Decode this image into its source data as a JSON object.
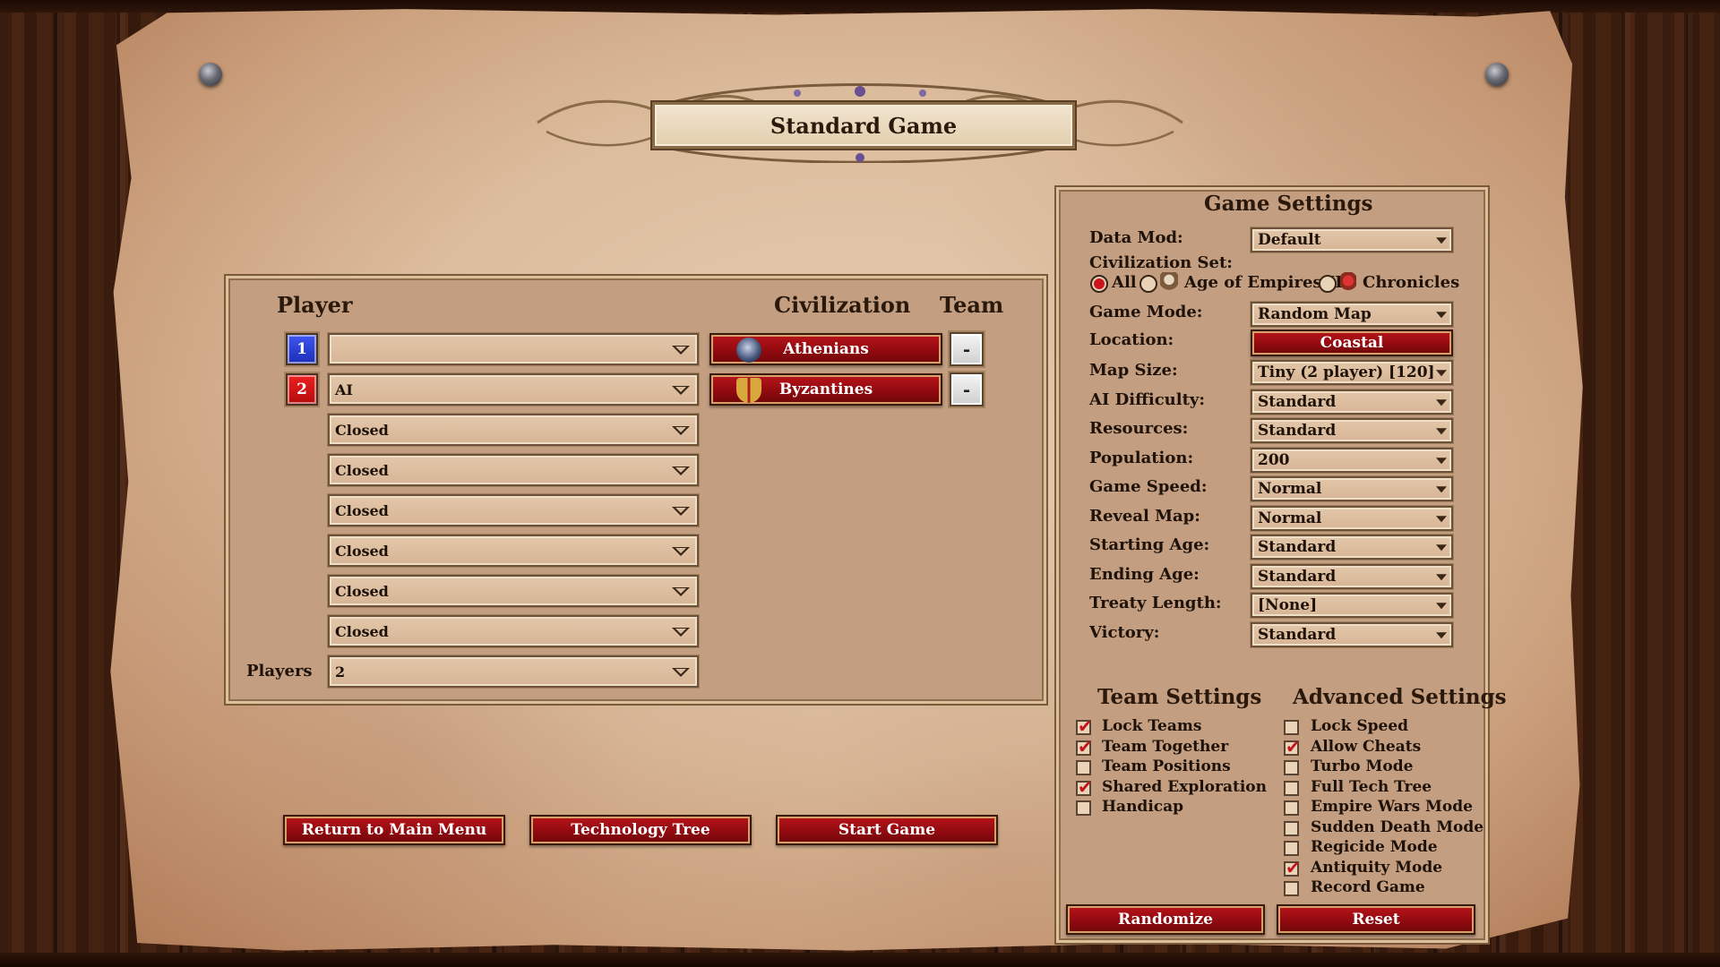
{
  "title": "Standard Game",
  "players_panel": {
    "header_player": "Player",
    "header_civ": "Civilization",
    "header_team": "Team",
    "rows": [
      {
        "number": "1",
        "color": "#2a3ed6",
        "slot": "",
        "civ": "Athenians",
        "team": "-"
      },
      {
        "number": "2",
        "color": "#d71616",
        "slot": "AI",
        "civ": "Byzantines",
        "team": "-"
      },
      {
        "slot": "Closed"
      },
      {
        "slot": "Closed"
      },
      {
        "slot": "Closed"
      },
      {
        "slot": "Closed"
      },
      {
        "slot": "Closed"
      },
      {
        "slot": "Closed"
      }
    ],
    "players_label": "Players",
    "players_value": "2"
  },
  "bottom_buttons": {
    "return": "Return to Main Menu",
    "tech_tree": "Technology Tree",
    "start": "Start Game"
  },
  "settings": {
    "header": "Game Settings",
    "data_mod_label": "Data Mod:",
    "data_mod": "Default",
    "civ_set_label": "Civilization Set:",
    "civ_set_options": [
      "All",
      "Age of Empires II",
      "Chronicles"
    ],
    "civ_set_selected": "All",
    "game_mode_label": "Game Mode:",
    "game_mode": "Random Map",
    "location_label": "Location:",
    "location": "Coastal",
    "map_size_label": "Map Size:",
    "map_size": "Tiny (2 player) [120]",
    "ai_difficulty_label": "AI Difficulty:",
    "ai_difficulty": "Standard",
    "resources_label": "Resources:",
    "resources": "Standard",
    "population_label": "Population:",
    "population": "200",
    "game_speed_label": "Game Speed:",
    "game_speed": "Normal",
    "reveal_map_label": "Reveal Map:",
    "reveal_map": "Normal",
    "starting_age_label": "Starting Age:",
    "starting_age": "Standard",
    "ending_age_label": "Ending Age:",
    "ending_age": "Standard",
    "treaty_length_label": "Treaty Length:",
    "treaty_length": "[None]",
    "victory_label": "Victory:",
    "victory": "Standard"
  },
  "team_settings": {
    "header": "Team Settings",
    "items": [
      {
        "label": "Lock Teams",
        "checked": true
      },
      {
        "label": "Team Together",
        "checked": true
      },
      {
        "label": "Team Positions",
        "checked": false
      },
      {
        "label": "Shared Exploration",
        "checked": true
      },
      {
        "label": "Handicap",
        "checked": false
      }
    ]
  },
  "advanced_settings": {
    "header": "Advanced Settings",
    "items": [
      {
        "label": "Lock Speed",
        "checked": false
      },
      {
        "label": "Allow Cheats",
        "checked": true
      },
      {
        "label": "Turbo Mode",
        "checked": false
      },
      {
        "label": "Full Tech Tree",
        "checked": false
      },
      {
        "label": "Empire Wars Mode",
        "checked": false
      },
      {
        "label": "Sudden Death Mode",
        "checked": false
      },
      {
        "label": "Regicide Mode",
        "checked": false
      },
      {
        "label": "Antiquity Mode",
        "checked": true
      },
      {
        "label": "Record Game",
        "checked": false
      }
    ]
  },
  "footer_buttons": {
    "randomize": "Randomize",
    "reset": "Reset"
  }
}
